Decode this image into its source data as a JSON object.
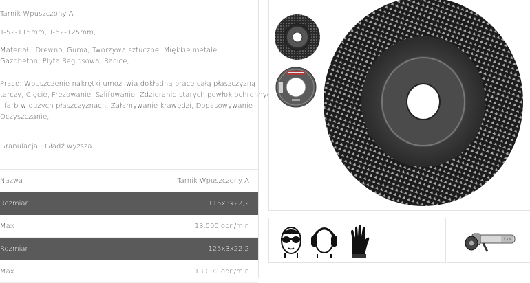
{
  "description": {
    "line1": "Tarnik Wpuszczony-A",
    "line2": "T-52-115mm, T-62-125mm,",
    "line3": "Materiał : Drewno, Guma, Tworzywa sztuczne, Miękkie metale,",
    "line4": "Gazobeton, Płyta Regipsowa, Racice,",
    "line5": "Prace: Wpuszczenie nakrętki umożliwia dokładną pracę całą płaszczyzną",
    "line6": "tarczy, Cięcie, Frezowanie, Szlifowanie, Zdzieranie starych powłok ochronnych",
    "line7": "i farb w dużych płaszczyznach, Załamywanie krawędzi, Dopasowywanie",
    "line8": "Oczyszczanie,",
    "line9": "Granulacja : Gładź wyższa"
  },
  "spec_table": [
    {
      "label": "Nazwa",
      "value": "Tarnik Wpuszczony-A",
      "style": "light"
    },
    {
      "label": "Rozmiar",
      "value": "115x3x22,2",
      "style": "dark"
    },
    {
      "label": "Max",
      "value": "13.000 obr./min",
      "style": "light"
    },
    {
      "label": "Rozmiar",
      "value": "125x3x22,2",
      "style": "dark"
    },
    {
      "label": "Max",
      "value": "13.000 obr./min",
      "style": "light"
    }
  ],
  "product_images": {
    "main": "rasp-disc-large",
    "thumb1": "rasp-disc-top-view",
    "thumb2": "disc-label-back-view"
  },
  "safety_icons": [
    "safety-goggles-icon",
    "ear-protection-icon",
    "protective-glove-icon"
  ],
  "tool_icon": "angle-grinder-icon",
  "colors": {
    "dark_row": "#5a5a5a",
    "border": "#e3e3e3",
    "text": "#555555"
  }
}
